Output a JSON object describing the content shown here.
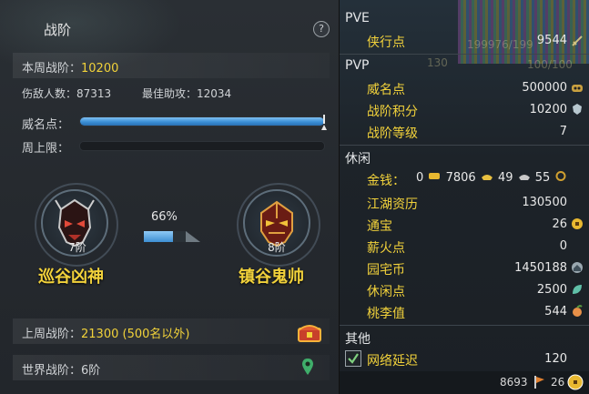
{
  "left": {
    "title": "战阶",
    "help": "?",
    "weekly_label": "本周战阶：",
    "weekly_value": "10200",
    "kills_label": "伤敌人数：",
    "kills_value": "87313",
    "assist_label": "最佳助攻：",
    "assist_value": "12034",
    "prestige_label": "威名点：",
    "prestige_progress": 1.0,
    "weekly_cap_label": "周上限：",
    "weekly_cap_progress": 0.0,
    "current_rank": {
      "level": "7阶",
      "name": "巡谷凶神"
    },
    "next_rank": {
      "level": "8阶",
      "name": "镇谷鬼帅"
    },
    "progress_pct": "66%",
    "progress_fraction": 0.66,
    "last_week_label": "上周战阶：",
    "last_week_value": "21300 (500名以外)",
    "world_label": "世界战阶：",
    "world_value": "6阶"
  },
  "right": {
    "bg_text": [
      "199976/199",
      "130",
      "100/100"
    ],
    "pve": {
      "header": "PVE",
      "items": [
        {
          "label": "侠行点",
          "value": "9544",
          "icon": "sword-icon"
        }
      ]
    },
    "pvp": {
      "header": "PVP",
      "items": [
        {
          "label": "威名点",
          "value": "500000",
          "icon": "mask-icon"
        },
        {
          "label": "战阶积分",
          "value": "10200",
          "icon": "crest-icon"
        },
        {
          "label": "战阶等级",
          "value": "7"
        }
      ]
    },
    "leisure": {
      "header": "休闲",
      "gold_label": "金钱：",
      "gold": [
        "0",
        "7806",
        "49",
        "55"
      ],
      "items": [
        {
          "label": "江湖资历",
          "value": "130500"
        },
        {
          "label": "通宝",
          "value": "26",
          "icon": "coin-icon"
        },
        {
          "label": "薪火点",
          "value": "0"
        },
        {
          "label": "园宅币",
          "value": "1450188",
          "icon": "house-coin-icon"
        },
        {
          "label": "休闲点",
          "value": "2500",
          "icon": "leaf-icon"
        },
        {
          "label": "桃李值",
          "value": "544",
          "icon": "peach-icon"
        }
      ]
    },
    "other": {
      "header": "其他",
      "latency_label": "网络延迟",
      "latency_value": "120"
    },
    "footer": {
      "left_value": "8693",
      "right_value": "26"
    }
  },
  "colors": {
    "accent": "#f1d23a",
    "bar": "#3b8fd6"
  }
}
